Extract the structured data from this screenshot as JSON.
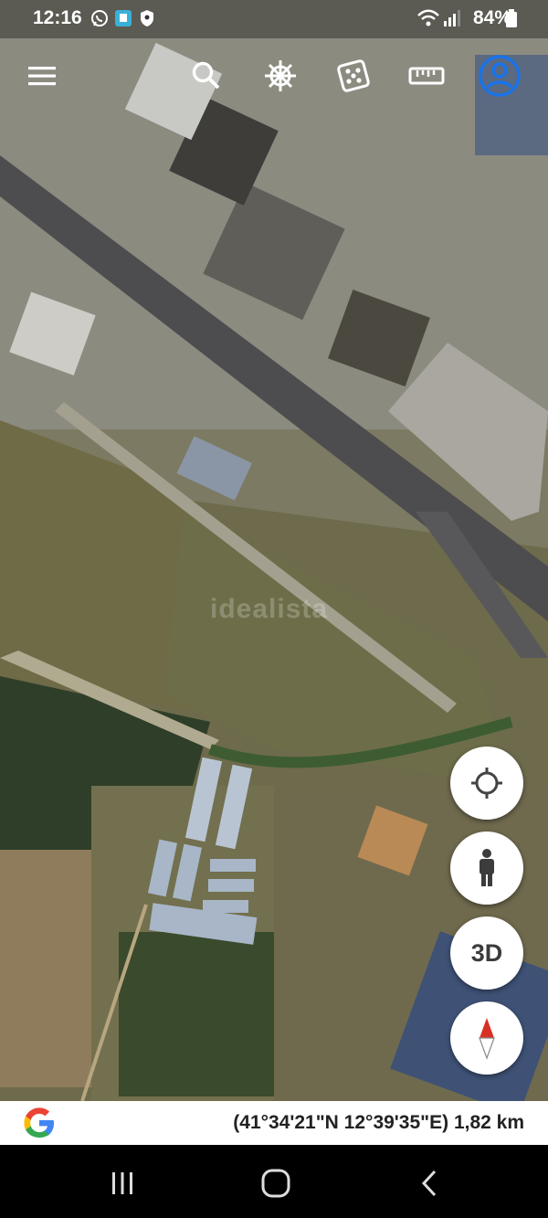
{
  "status_bar": {
    "time": "12:16",
    "battery": "84%",
    "notification_icons": [
      "whatsapp-icon",
      "app-notification-icon",
      "shield-icon"
    ],
    "system_icons": [
      "wifi-icon",
      "signal-icon",
      "battery-icon"
    ]
  },
  "toolbar": {
    "items": [
      "menu-icon",
      "search-icon",
      "voyager-wheel-icon",
      "dice-icon",
      "ruler-icon",
      "account-icon"
    ]
  },
  "map": {
    "watermark": "idealista"
  },
  "controls": {
    "locate_icon": "my-location-icon",
    "street_view_icon": "pegman-icon",
    "three_d_label": "3D",
    "compass_icon": "compass-icon"
  },
  "info_bar": {
    "logo": "G",
    "coordinates": "(41°34'21\"N 12°39'35\"E) 1,82 km"
  },
  "nav_bar": {
    "items": [
      "recent-apps-icon",
      "home-icon",
      "back-icon"
    ]
  },
  "colors": {
    "google_blue": "#4285F4",
    "google_red": "#EA4335",
    "google_yellow": "#FBBC05",
    "google_green": "#34A853",
    "account_ring": "#1a73e8",
    "compass_red": "#d93025"
  }
}
